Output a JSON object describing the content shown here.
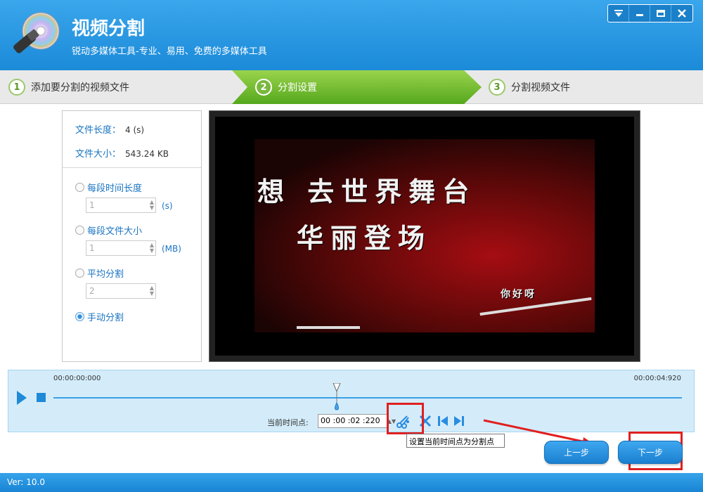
{
  "app": {
    "title": "视频分割",
    "subtitle": "锐动多媒体工具-专业、易用、免费的多媒体工具",
    "version": "Ver: 10.0"
  },
  "steps": [
    {
      "num": "1",
      "label": "添加要分割的视频文件"
    },
    {
      "num": "2",
      "label": "分割设置"
    },
    {
      "num": "3",
      "label": "分割视频文件"
    }
  ],
  "info": {
    "length_label": "文件长度：",
    "length_value": "4 (s)",
    "size_label": "文件大小：",
    "size_value": "543.24 KB"
  },
  "options": {
    "per_time": {
      "label": "每段时间长度",
      "value": "1",
      "unit": "(s)"
    },
    "per_size": {
      "label": "每段文件大小",
      "value": "1",
      "unit": "(MB)"
    },
    "average": {
      "label": "平均分割",
      "value": "2"
    },
    "manual": {
      "label": "手动分割"
    }
  },
  "video": {
    "line1": "想 去世界舞台",
    "line2": "华丽登场",
    "small": "你好呀"
  },
  "timeline": {
    "start": "00:00:00:000",
    "end": "00:00:04:920",
    "current_label": "当前时间点:",
    "current_value": "00 :00 :02 :220"
  },
  "tooltip": "设置当前时间点为分割点",
  "buttons": {
    "prev": "上一步",
    "next": "下一步"
  }
}
